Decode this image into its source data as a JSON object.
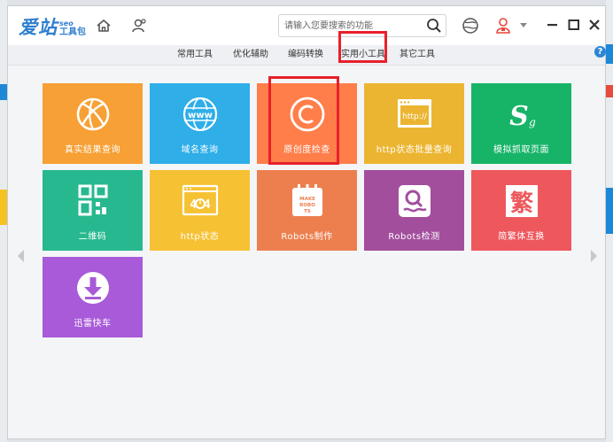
{
  "app": {
    "logo_main": "爱站",
    "logo_seo": "seo",
    "logo_sub": "工具包"
  },
  "search": {
    "placeholder": "请输入您要搜索的功能",
    "value": ""
  },
  "tabs": [
    {
      "label": "常用工具"
    },
    {
      "label": "优化辅助"
    },
    {
      "label": "编码转换"
    },
    {
      "label": "实用小工具",
      "active": true
    },
    {
      "label": "其它工具"
    }
  ],
  "help_label": "?",
  "tiles": [
    {
      "label": "真实结果查询",
      "color": "#f7a035",
      "icon": "basketball-icon"
    },
    {
      "label": "域名查询",
      "color": "#2faee8",
      "icon": "www-globe-icon"
    },
    {
      "label": "原创度检查",
      "color": "#ff7e4a",
      "icon": "copyright-icon"
    },
    {
      "label": "http状态批量查询",
      "color": "#ecb531",
      "icon": "http-browser-icon"
    },
    {
      "label": "模拟抓取页面",
      "color": "#17b468",
      "icon": "sg-logo-icon"
    },
    {
      "label": "二维码",
      "color": "#27b88f",
      "icon": "qr-code-icon"
    },
    {
      "label": "http状态",
      "color": "#f6c234",
      "icon": "error-404-icon"
    },
    {
      "label": "Robots制作",
      "color": "#ed7f4f",
      "icon": "robots-calendar-icon"
    },
    {
      "label": "Robots检测",
      "color": "#a24e9d",
      "icon": "robot-face-icon"
    },
    {
      "label": "简繁体互换",
      "color": "#ee585d",
      "icon": "traditional-char-icon"
    },
    {
      "label": "迅雷快车",
      "color": "#a85ad9",
      "icon": "download-icon"
    }
  ],
  "icon_text": {
    "http": "http://",
    "err404": "4 4",
    "make_robots": "MAKE ROBOTS",
    "fan": "繁",
    "sg": "S"
  },
  "colors": {
    "accent": "#2f7fd0",
    "highlight": "#e8202a"
  }
}
